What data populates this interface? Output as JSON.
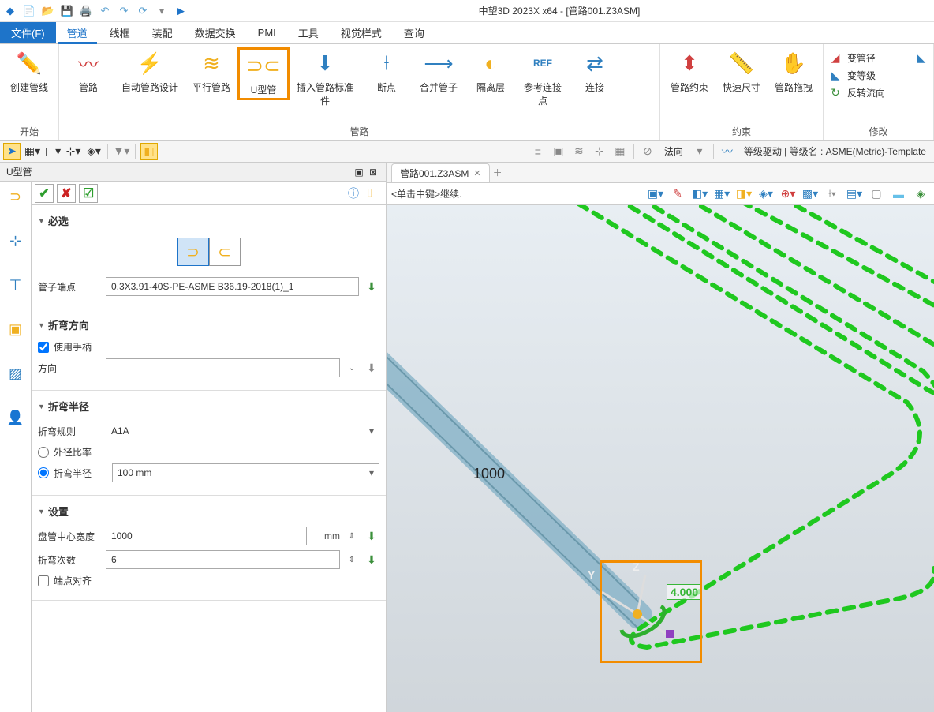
{
  "app": {
    "title": "中望3D 2023X x64 - [管路001.Z3ASM]"
  },
  "menu": {
    "file": "文件(F)",
    "tabs": [
      "管道",
      "线框",
      "装配",
      "数据交换",
      "PMI",
      "工具",
      "视觉样式",
      "查询"
    ],
    "active": "管道"
  },
  "ribbon": {
    "groups": [
      {
        "label": "开始",
        "items": [
          {
            "name": "创建管线",
            "icon": "✏️"
          }
        ]
      },
      {
        "label": "管路",
        "items": [
          {
            "name": "管路",
            "icon": "〰️"
          },
          {
            "name": "自动管路设计",
            "icon": "⚡"
          },
          {
            "name": "平行管路",
            "icon": "∥"
          },
          {
            "name": "U型管",
            "icon": "🔄",
            "highlighted": true
          },
          {
            "name": "插入管路标准件",
            "icon": "🔧"
          },
          {
            "name": "断点",
            "icon": "⟊"
          },
          {
            "name": "合并管子",
            "icon": "⟶"
          },
          {
            "name": "隔离层",
            "icon": "◐"
          },
          {
            "name": "参考连接点",
            "icon": "REF"
          },
          {
            "name": "连接",
            "icon": "⇄"
          }
        ]
      },
      {
        "label": "约束",
        "items": [
          {
            "name": "管路约束",
            "icon": "🔗"
          },
          {
            "name": "快速尺寸",
            "icon": "📏"
          },
          {
            "name": "管路拖拽",
            "icon": "✋"
          }
        ]
      },
      {
        "label": "修改",
        "small": true,
        "items": [
          {
            "name": "变管径",
            "icon": "◢"
          },
          {
            "name": "变等级",
            "icon": "◣"
          },
          {
            "name": "反转流向",
            "icon": "↻"
          }
        ]
      }
    ]
  },
  "toolstrip": {
    "direction_label": "法向",
    "status": "等级驱动 | 等级名 : ASME(Metric)-Template"
  },
  "panel": {
    "title": "U型管",
    "sections": {
      "required": {
        "title": "必选",
        "endpoint_label": "管子端点",
        "endpoint_value": "0.3X3.91-40S-PE-ASME B36.19-2018(1)_1"
      },
      "bend_direction": {
        "title": "折弯方向",
        "use_handle": "使用手柄",
        "use_handle_checked": true,
        "direction_label": "方向",
        "direction_value": ""
      },
      "bend_radius": {
        "title": "折弯半径",
        "rule_label": "折弯规则",
        "rule_value": "A1A",
        "ratio_label": "外径比率",
        "radius_label": "折弯半径",
        "radius_value": "100 mm",
        "radius_selected": true
      },
      "settings": {
        "title": "设置",
        "center_width_label": "盘管中心宽度",
        "center_width_value": "1000",
        "center_width_unit": "mm",
        "bend_count_label": "折弯次数",
        "bend_count_value": "6",
        "align_label": "端点对齐",
        "align_checked": false
      }
    }
  },
  "viewport": {
    "tab": "管路001.Z3ASM",
    "hint": "<单击中键>继续.",
    "dim_value": "1000",
    "gizmo_value": "4.000",
    "axis_y": "Y",
    "axis_z": "Z"
  }
}
